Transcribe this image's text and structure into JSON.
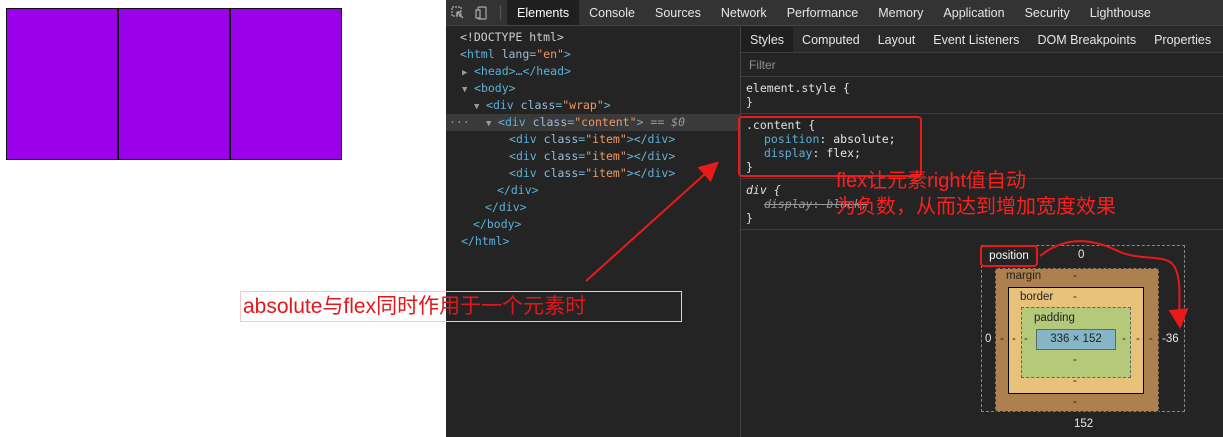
{
  "devtools": {
    "tabs": [
      "Elements",
      "Console",
      "Sources",
      "Network",
      "Performance",
      "Memory",
      "Application",
      "Security",
      "Lighthouse"
    ],
    "active_tab": "Elements"
  },
  "dom": {
    "doctype": "<!DOCTYPE html>",
    "html_tag": "html",
    "html_attr": "lang",
    "html_val": "\"en\"",
    "head_text": "<head>…</head>",
    "body_tag": "body",
    "div_tag": "div",
    "class_attr": "class",
    "wrap_val": "\"wrap\"",
    "content_val": "\"content\"",
    "item_val": "\"item\"",
    "eq_marker": "== $0",
    "close_div": "</div>",
    "close_body": "</body>",
    "close_html": "</html>"
  },
  "styles": {
    "subtabs": [
      "Styles",
      "Computed",
      "Layout",
      "Event Listeners",
      "DOM Breakpoints",
      "Properties"
    ],
    "active_subtab": "Styles",
    "filter_placeholder": "Filter",
    "element_style": "element.style {",
    "close_brace": "}",
    "content_selector": ".content {",
    "content_props": [
      {
        "name": "position",
        "value": "absolute;"
      },
      {
        "name": "display",
        "value": "flex;"
      }
    ],
    "div_selector": "div {",
    "div_prop_name": "display",
    "div_prop_value": "block;"
  },
  "box_model": {
    "position_label": "position",
    "position_top": "0",
    "position_left": "0",
    "position_right": "-36",
    "position_bottom": "152",
    "margin_label": "margin",
    "border_label": "border",
    "padding_label": "padding",
    "dash": "-",
    "content_size": "336 × 152"
  },
  "annotations": {
    "left_note": "absolute与flex同时作用于一个元素时",
    "right_note_line1": "flex让元素right值自动",
    "right_note_line2": "为负数，从而达到增加宽度效果"
  },
  "colors": {
    "item_fill": "#9b00ea",
    "annotation_red": "#e81a1a"
  }
}
